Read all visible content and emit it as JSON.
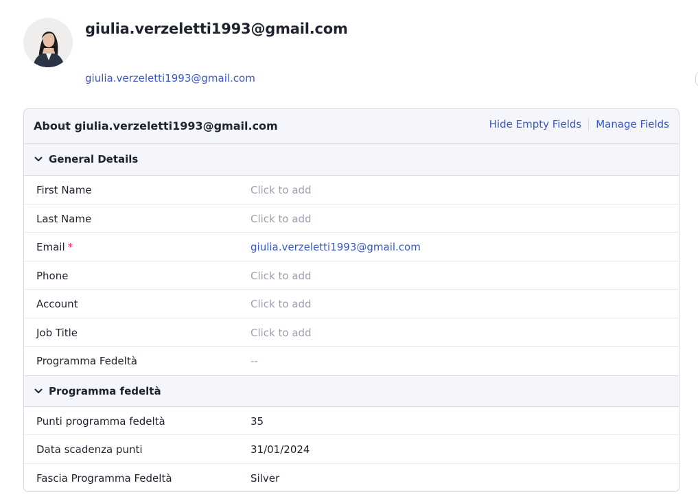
{
  "contact": {
    "title": "giulia.verzeletti1993@gmail.com",
    "email_link": "giulia.verzeletti1993@gmail.com",
    "avatar_icon": "profile-photo"
  },
  "about": {
    "title": "About giulia.verzeletti1993@gmail.com",
    "hide_empty_label": "Hide Empty Fields",
    "manage_fields_label": "Manage Fields"
  },
  "sections": [
    {
      "title": "General Details",
      "icon": "chevron-down-icon",
      "fields": [
        {
          "label": "First Name",
          "value": "Click to add",
          "required": false
        },
        {
          "label": "Last Name",
          "value": "Click to add",
          "required": false
        },
        {
          "label": "Email",
          "value": "giulia.verzeletti1993@gmail.com",
          "required": true,
          "required_mark": "*"
        },
        {
          "label": "Phone",
          "value": "Click to add",
          "required": false
        },
        {
          "label": "Account",
          "value": "Click to add",
          "required": false
        },
        {
          "label": "Job Title",
          "value": "Click to add",
          "required": false
        },
        {
          "label": "Programma Fedeltà",
          "value": "--",
          "required": false
        }
      ]
    },
    {
      "title": "Programma fedeltà",
      "icon": "chevron-down-icon",
      "fields": [
        {
          "label": "Punti programma fedeltà",
          "value": "35"
        },
        {
          "label": "Data scadenza punti",
          "value": "31/01/2024"
        },
        {
          "label": "Fascia Programma Fedeltà",
          "value": "Silver"
        }
      ]
    }
  ],
  "colors": {
    "link": "#3858c7",
    "placeholder": "#9aa0b0",
    "required": "#e0245e",
    "header_bg": "#f5f6fb",
    "border": "#d5d9e3"
  }
}
